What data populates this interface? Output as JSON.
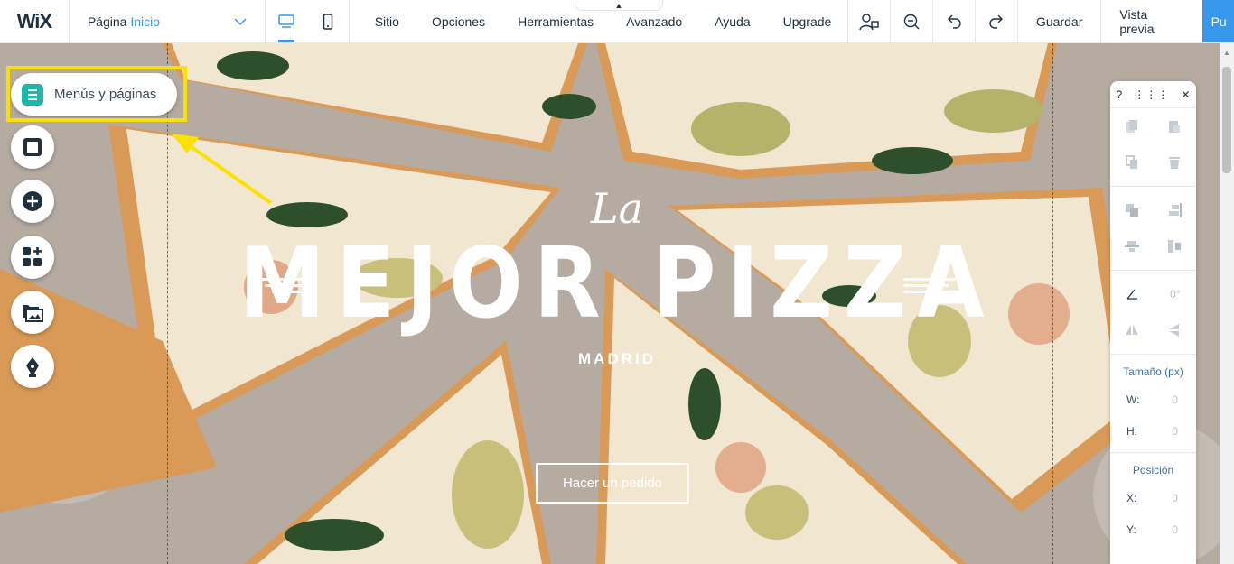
{
  "topbar": {
    "logo": "WiX",
    "page_label": "Página",
    "page_value": "Inicio",
    "menu": [
      "Sitio",
      "Opciones",
      "Herramientas",
      "Avanzado",
      "Ayuda",
      "Upgrade"
    ],
    "save": "Guardar",
    "preview": "Vista previa",
    "publish": "Pu"
  },
  "hero": {
    "la": "La",
    "title": "MEJOR PIZZA",
    "subtitle": "MADRID",
    "button": "Hacer un pedido"
  },
  "left_rail": {
    "menus_label": "Menús y páginas"
  },
  "panel": {
    "help": "?",
    "rotation": "0°",
    "size_title": "Tamaño (px)",
    "w_label": "W:",
    "w_value": "0",
    "h_label": "H:",
    "h_value": "0",
    "pos_title": "Posición",
    "x_label": "X:",
    "x_value": "0",
    "y_label": "Y:",
    "y_value": "0"
  },
  "colors": {
    "accent": "#3899ec",
    "highlight": "#f9e200",
    "pages_icon": "#1bb7a8"
  }
}
